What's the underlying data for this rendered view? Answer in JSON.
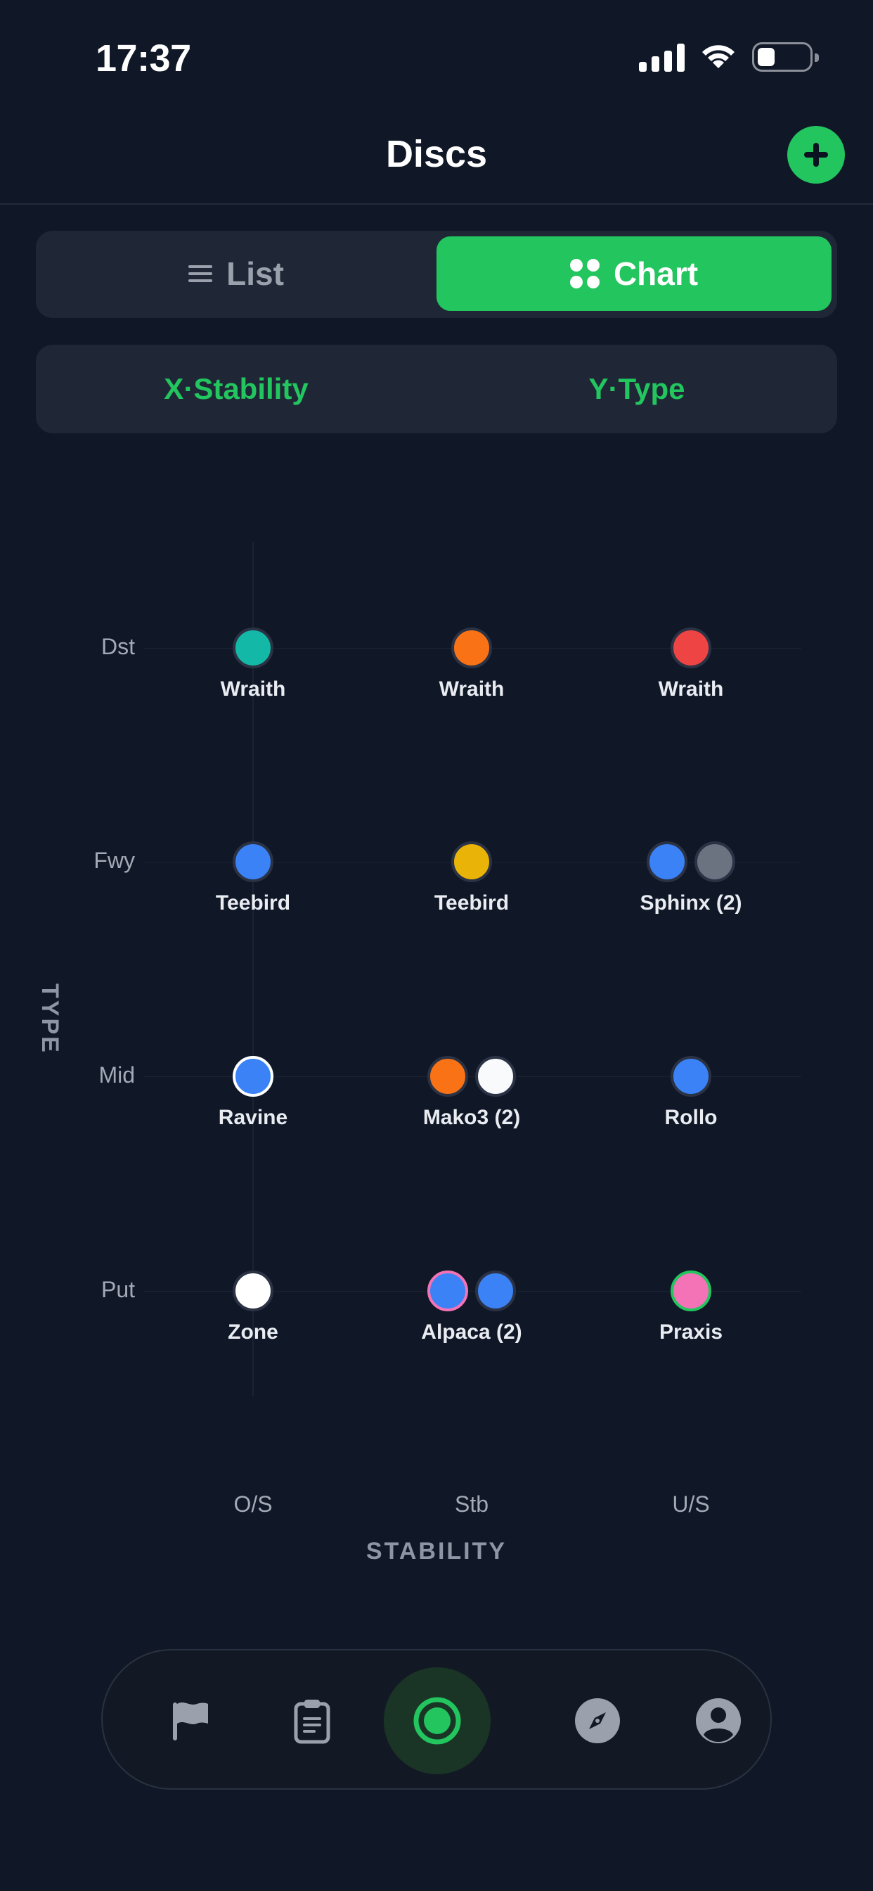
{
  "status_bar": {
    "time": "17:37"
  },
  "header": {
    "title": "Discs",
    "add_icon": "plus-icon"
  },
  "view_toggle": {
    "options": [
      {
        "label": "List",
        "icon": "list-icon",
        "selected": false
      },
      {
        "label": "Chart",
        "icon": "grid-dots-icon",
        "selected": true
      }
    ]
  },
  "axis_selector": {
    "x_prefix": "X",
    "x_label": "Stability",
    "y_prefix": "Y",
    "y_label": "Type",
    "separator": "·"
  },
  "chart": {
    "y_title": "TYPE",
    "x_title": "STABILITY",
    "y_ticks": [
      "Dst",
      "Fwy",
      "Mid",
      "Put"
    ],
    "x_ticks": [
      "O/S",
      "Stb",
      "U/S"
    ]
  },
  "chart_data": {
    "type": "scatter",
    "xlabel": "STABILITY",
    "ylabel": "TYPE",
    "x_categories": [
      "O/S",
      "Stb",
      "U/S"
    ],
    "y_categories": [
      "Dst",
      "Fwy",
      "Mid",
      "Put"
    ],
    "points": [
      {
        "x": "O/S",
        "y": "Dst",
        "label": "Wraith",
        "discs": [
          {
            "color": "#14b8a6"
          }
        ]
      },
      {
        "x": "Stb",
        "y": "Dst",
        "label": "Wraith",
        "discs": [
          {
            "color": "#f97316"
          }
        ]
      },
      {
        "x": "U/S",
        "y": "Dst",
        "label": "Wraith",
        "discs": [
          {
            "color": "#ef4444"
          }
        ]
      },
      {
        "x": "O/S",
        "y": "Fwy",
        "label": "Teebird",
        "discs": [
          {
            "color": "#3b82f6"
          }
        ]
      },
      {
        "x": "Stb",
        "y": "Fwy",
        "label": "Teebird",
        "discs": [
          {
            "color": "#eab308"
          }
        ]
      },
      {
        "x": "U/S",
        "y": "Fwy",
        "label": "Sphinx (2)",
        "discs": [
          {
            "color": "#3b82f6"
          },
          {
            "color": "#6b7280"
          }
        ]
      },
      {
        "x": "O/S",
        "y": "Mid",
        "label": "Ravine",
        "discs": [
          {
            "color": "#3b82f6",
            "ring": "#ffffff"
          }
        ]
      },
      {
        "x": "Stb",
        "y": "Mid",
        "label": "Mako3 (2)",
        "discs": [
          {
            "color": "#f97316"
          },
          {
            "color": "#f8fafc"
          }
        ]
      },
      {
        "x": "U/S",
        "y": "Mid",
        "label": "Rollo",
        "discs": [
          {
            "color": "#3b82f6"
          }
        ]
      },
      {
        "x": "O/S",
        "y": "Put",
        "label": "Zone",
        "discs": [
          {
            "color": "#ffffff"
          }
        ]
      },
      {
        "x": "Stb",
        "y": "Put",
        "label": "Alpaca (2)",
        "discs": [
          {
            "color": "#3b82f6",
            "ring": "#f472b6"
          },
          {
            "color": "#3b82f6"
          }
        ]
      },
      {
        "x": "U/S",
        "y": "Put",
        "label": "Praxis",
        "discs": [
          {
            "color": "#f472b6",
            "ring": "#22c55e"
          }
        ]
      }
    ]
  },
  "bottom_nav": {
    "items": [
      {
        "icon": "flag-icon",
        "active": false
      },
      {
        "icon": "clipboard-icon",
        "active": false
      },
      {
        "icon": "disc-icon",
        "active": true
      },
      {
        "icon": "compass-icon",
        "active": false
      },
      {
        "icon": "profile-icon",
        "active": false
      }
    ]
  },
  "colors": {
    "accent": "#22c55e",
    "background": "#101727",
    "panel": "#1f2736"
  }
}
